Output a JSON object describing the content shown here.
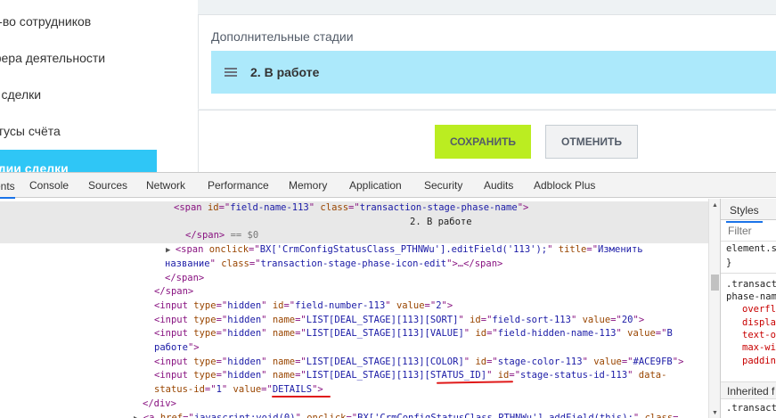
{
  "crm": {
    "menu": [
      {
        "label": "Кол-во сотрудников",
        "display": "л-во сотрудников"
      },
      {
        "label": "Сфера деятельности",
        "display": "фера деятельности"
      },
      {
        "label": "Тип сделки",
        "display": "п сделки"
      },
      {
        "label": "Статусы счёта",
        "display": "атусы счёта"
      },
      {
        "label": "Стадии сделки",
        "display": "адии сделки"
      }
    ],
    "stages_title": "Дополнительные стадии",
    "stage_name": "2. В работе",
    "save_label": "СОХРАНИТЬ",
    "cancel_label": "ОТМЕНИТЬ",
    "colors": {
      "stage_bg": "#ACE9FB",
      "save_bg": "#bbed21",
      "active_menu": "#2fc6f6"
    }
  },
  "devtools": {
    "tabs": [
      "ents",
      "Console",
      "Sources",
      "Network",
      "Performance",
      "Memory",
      "Application",
      "Security",
      "Audits",
      "Adblock Plus"
    ],
    "dom_lines": [
      {
        "indent": 195,
        "parts": [
          [
            "t",
            "<span "
          ],
          [
            "an",
            "id"
          ],
          [
            "t",
            "=\""
          ],
          [
            "av",
            "field-name-113"
          ],
          [
            "t",
            "\" "
          ],
          [
            "an",
            "class"
          ],
          [
            "t",
            "=\""
          ],
          [
            "av",
            "transaction-stage-phase-name"
          ],
          [
            "t",
            "\">"
          ]
        ],
        "hl": true
      },
      {
        "indent": 460,
        "parts": [
          [
            "tx",
            "2. В работе"
          ]
        ],
        "hl": true
      },
      {
        "indent": 208,
        "parts": [
          [
            "t",
            "</span>"
          ],
          [
            "gr",
            " == $0"
          ]
        ],
        "hl": true
      },
      {
        "indent": 186,
        "tri": "▶",
        "parts": [
          [
            "t",
            "<span "
          ],
          [
            "an",
            "onclick"
          ],
          [
            "t",
            "=\""
          ],
          [
            "av",
            "BX['CrmConfigStatusClass_PTHNWu'].editField('113');"
          ],
          [
            "t",
            "\" "
          ],
          [
            "an",
            "title"
          ],
          [
            "t",
            "=\""
          ],
          [
            "av",
            "Изменить"
          ]
        ]
      },
      {
        "indent": 185,
        "parts": [
          [
            "av",
            "название"
          ],
          [
            "t",
            "\" "
          ],
          [
            "an",
            "class"
          ],
          [
            "t",
            "=\""
          ],
          [
            "av",
            "transaction-stage-phase-icon-edit"
          ],
          [
            "t",
            "\">…</span>"
          ]
        ]
      },
      {
        "indent": 185,
        "parts": [
          [
            "t",
            "</span>"
          ]
        ]
      },
      {
        "indent": 173,
        "parts": [
          [
            "t",
            "</span>"
          ]
        ]
      },
      {
        "indent": 173,
        "parts": [
          [
            "t",
            "<input "
          ],
          [
            "an",
            "type"
          ],
          [
            "t",
            "=\""
          ],
          [
            "av",
            "hidden"
          ],
          [
            "t",
            "\" "
          ],
          [
            "an",
            "id"
          ],
          [
            "t",
            "=\""
          ],
          [
            "av",
            "field-number-113"
          ],
          [
            "t",
            "\" "
          ],
          [
            "an",
            "value"
          ],
          [
            "t",
            "=\""
          ],
          [
            "av",
            "2"
          ],
          [
            "t",
            "\">"
          ]
        ]
      },
      {
        "indent": 173,
        "parts": [
          [
            "t",
            "<input "
          ],
          [
            "an",
            "type"
          ],
          [
            "t",
            "=\""
          ],
          [
            "av",
            "hidden"
          ],
          [
            "t",
            "\" "
          ],
          [
            "an",
            "name"
          ],
          [
            "t",
            "=\""
          ],
          [
            "av",
            "LIST[DEAL_STAGE][113][SORT]"
          ],
          [
            "t",
            "\" "
          ],
          [
            "an",
            "id"
          ],
          [
            "t",
            "=\""
          ],
          [
            "av",
            "field-sort-113"
          ],
          [
            "t",
            "\" "
          ],
          [
            "an",
            "value"
          ],
          [
            "t",
            "=\""
          ],
          [
            "av",
            "20"
          ],
          [
            "t",
            "\">"
          ]
        ]
      },
      {
        "indent": 173,
        "parts": [
          [
            "t",
            "<input "
          ],
          [
            "an",
            "type"
          ],
          [
            "t",
            "=\""
          ],
          [
            "av",
            "hidden"
          ],
          [
            "t",
            "\" "
          ],
          [
            "an",
            "name"
          ],
          [
            "t",
            "=\""
          ],
          [
            "av",
            "LIST[DEAL_STAGE][113][VALUE]"
          ],
          [
            "t",
            "\" "
          ],
          [
            "an",
            "id"
          ],
          [
            "t",
            "=\""
          ],
          [
            "av",
            "field-hidden-name-113"
          ],
          [
            "t",
            "\" "
          ],
          [
            "an",
            "value"
          ],
          [
            "t",
            "=\""
          ],
          [
            "av",
            "В"
          ]
        ]
      },
      {
        "indent": 173,
        "parts": [
          [
            "av",
            "работе"
          ],
          [
            "t",
            "\">"
          ]
        ]
      },
      {
        "indent": 173,
        "parts": [
          [
            "t",
            "<input "
          ],
          [
            "an",
            "type"
          ],
          [
            "t",
            "=\""
          ],
          [
            "av",
            "hidden"
          ],
          [
            "t",
            "\" "
          ],
          [
            "an",
            "name"
          ],
          [
            "t",
            "=\""
          ],
          [
            "av",
            "LIST[DEAL_STAGE][113][COLOR]"
          ],
          [
            "t",
            "\" "
          ],
          [
            "an",
            "id"
          ],
          [
            "t",
            "=\""
          ],
          [
            "av",
            "stage-color-113"
          ],
          [
            "t",
            "\" "
          ],
          [
            "an",
            "value"
          ],
          [
            "t",
            "=\""
          ],
          [
            "av",
            "#ACE9FB"
          ],
          [
            "t",
            "\">"
          ]
        ]
      },
      {
        "indent": 173,
        "parts": [
          [
            "t",
            "<input "
          ],
          [
            "an",
            "type"
          ],
          [
            "t",
            "=\""
          ],
          [
            "av",
            "hidden"
          ],
          [
            "t",
            "\" "
          ],
          [
            "an",
            "name"
          ],
          [
            "t",
            "=\""
          ],
          [
            "av",
            "LIST[DEAL_STAGE][113][STATUS_ID]"
          ],
          [
            "t",
            "\" "
          ],
          [
            "an",
            "id"
          ],
          [
            "t",
            "=\""
          ],
          [
            "av",
            "stage-status-id-113"
          ],
          [
            "t",
            "\" "
          ],
          [
            "an",
            "data-"
          ]
        ]
      },
      {
        "indent": 173,
        "parts": [
          [
            "an",
            "status-id"
          ],
          [
            "t",
            "=\""
          ],
          [
            "av",
            "1"
          ],
          [
            "t",
            "\" "
          ],
          [
            "an",
            "value"
          ],
          [
            "t",
            "=\""
          ],
          [
            "av",
            "DETAILS"
          ],
          [
            "t",
            "\">"
          ]
        ]
      },
      {
        "indent": 160,
        "parts": [
          [
            "t",
            "</div>"
          ]
        ]
      },
      {
        "indent": 150,
        "tri": "▶",
        "parts": [
          [
            "t",
            "<a "
          ],
          [
            "an",
            "href"
          ],
          [
            "t",
            "=\""
          ],
          [
            "av",
            "javascript:void(0)"
          ],
          [
            "t",
            "\" "
          ],
          [
            "an",
            "onclick"
          ],
          [
            "t",
            "=\""
          ],
          [
            "av",
            "BX['CrmConfigStatusClass_PTHNWu'].addField(this);"
          ],
          [
            "t",
            "\" "
          ],
          [
            "an",
            "class"
          ],
          [
            "t",
            "="
          ]
        ]
      }
    ],
    "styles_tab": "Styles",
    "filter_placeholder": "Filter",
    "styles_lines": [
      "element.s",
      "}",
      ".transact",
      "phase-nam",
      "overfl",
      "displa",
      "text-o",
      "max-wi",
      "paddin"
    ],
    "inherited_label": "Inherited f",
    "styles_last": ".transact"
  }
}
